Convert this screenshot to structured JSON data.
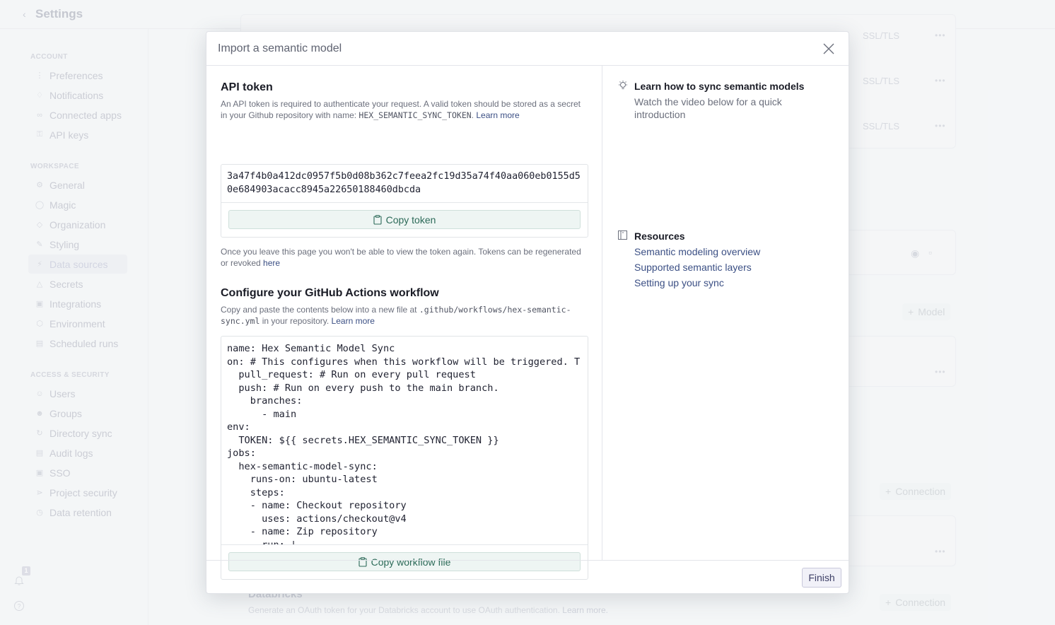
{
  "app": {
    "title": "Settings",
    "back_icon": "chevron-left-icon"
  },
  "sidebar": {
    "sections": [
      {
        "label": "ACCOUNT",
        "items": [
          {
            "label": "Preferences",
            "icon": "sliders-icon"
          },
          {
            "label": "Notifications",
            "icon": "bell-icon"
          },
          {
            "label": "Connected apps",
            "icon": "link-icon"
          },
          {
            "label": "API keys",
            "icon": "key-icon"
          }
        ]
      },
      {
        "label": "WORKSPACE",
        "items": [
          {
            "label": "General",
            "icon": "gear-icon"
          },
          {
            "label": "Magic",
            "icon": "magic-icon"
          },
          {
            "label": "Organization",
            "icon": "tag-icon"
          },
          {
            "label": "Styling",
            "icon": "brush-icon"
          },
          {
            "label": "Data sources",
            "icon": "database-icon",
            "active": true
          },
          {
            "label": "Secrets",
            "icon": "secret-icon"
          },
          {
            "label": "Integrations",
            "icon": "package-icon"
          },
          {
            "label": "Environment",
            "icon": "cube-icon"
          },
          {
            "label": "Scheduled runs",
            "icon": "calendar-icon"
          }
        ]
      },
      {
        "label": "ACCESS & SECURITY",
        "items": [
          {
            "label": "Users",
            "icon": "user-icon"
          },
          {
            "label": "Groups",
            "icon": "users-icon"
          },
          {
            "label": "Directory sync",
            "icon": "sync-icon"
          },
          {
            "label": "Audit logs",
            "icon": "archive-icon"
          },
          {
            "label": "SSO",
            "icon": "lock-icon"
          },
          {
            "label": "Project security",
            "icon": "share-icon"
          },
          {
            "label": "Data retention",
            "icon": "history-icon"
          }
        ]
      }
    ],
    "notification_count": "1"
  },
  "background": {
    "ssl_labels": [
      "SSL/TLS",
      "SSL/TLS",
      "SSL/TLS"
    ],
    "add_model_label": "Model",
    "add_connection_label": "Connection",
    "databricks_title": "Databricks",
    "databricks_desc": "Generate an OAuth token for your Databricks account to use OAuth authentication.",
    "databricks_link": "Learn more."
  },
  "modal": {
    "title": "Import a semantic model",
    "api_token": {
      "heading": "API token",
      "desc_prefix": "An API token is required to authenticate your request. A valid token should be stored as a secret in your Github repository with name: ",
      "secret_name": "HEX_SEMANTIC_SYNC_TOKEN",
      "desc_suffix": ". ",
      "learn_more": "Learn more",
      "token_value": "3a47f4b0a412dc0957f5b0d08b362c7feea2fc19d35a74f40aa060eb0155d50e684903acacc8945a22650188460dbcda",
      "copy_label": "Copy token",
      "note": "Once you leave this page you won't be able to view the token again. Tokens can be regenerated or revoked ",
      "note_link": "here"
    },
    "workflow": {
      "heading": "Configure your GitHub Actions workflow",
      "desc_prefix": "Copy and paste the contents below into a new file at ",
      "file_path": ".github/workflows/hex-semantic-sync.yml",
      "desc_suffix": " in your repository. ",
      "learn_more": "Learn more",
      "code": "name: Hex Semantic Model Sync\non: # This configures when this workflow will be triggered. T\n  pull_request: # Run on every pull request\n  push: # Run on every push to the main branch.\n    branches:\n      - main\nenv:\n  TOKEN: ${{ secrets.HEX_SEMANTIC_SYNC_TOKEN }}\njobs:\n  hex-semantic-model-sync:\n    runs-on: ubuntu-latest\n    steps:\n    - name: Checkout repository\n      uses: actions/checkout@v4\n    - name: Zip repository\n      run: |",
      "copy_label": "Copy workflow file"
    },
    "learn": {
      "title": "Learn how to sync semantic models",
      "desc": "Watch the video below for a quick introduction"
    },
    "resources": {
      "title": "Resources",
      "links": [
        "Semantic modeling overview",
        "Supported semantic layers",
        "Setting up your sync"
      ]
    },
    "finish_label": "Finish"
  }
}
